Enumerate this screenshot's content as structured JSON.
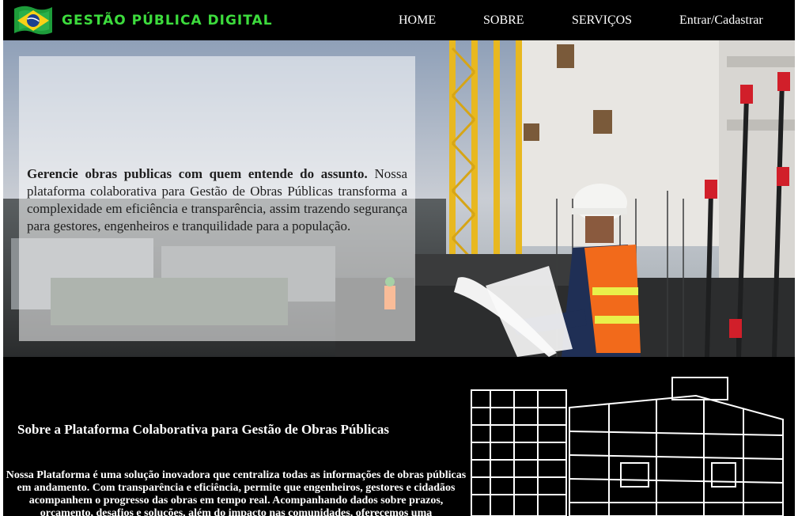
{
  "brand": {
    "name": "GESTÃO PÚBLICA DIGITAL",
    "logo_icon": "brazil-flag-icon"
  },
  "nav": {
    "items": [
      {
        "label": "HOME"
      },
      {
        "label": "SOBRE"
      },
      {
        "label": "SERVIÇOS"
      },
      {
        "label": "Entrar/Cadastrar"
      }
    ]
  },
  "hero": {
    "headline": "Gerencie obras publicas com quem entende do assunto.",
    "body": "Nossa plataforma colaborativa para Gestão de Obras Públicas transforma a complexidade em eficiência e transparência, assim trazendo segurança para gestores, engenheiros e tranquilidade para a população."
  },
  "about": {
    "title": "Sobre a Plataforma Colaborativa para Gestão de Obras Públicas",
    "body": "Nossa Plataforma é uma solução inovadora que centraliza todas as informações de obras públicas em andamento. Com transparência e eficiência, permite que engenheiros, gestores e cidadãos acompanhem o progresso das obras em tempo real. Acompanhando dados sobre prazos, orçamento, desafios e soluções, além do impacto nas comunidades, oferecemos uma"
  },
  "colors": {
    "nav_bg": "#000000",
    "brand_green": "#3ddc3d",
    "about_bg": "#000000",
    "vest_orange": "#f26a1b",
    "crane_yellow": "#e8b820"
  }
}
